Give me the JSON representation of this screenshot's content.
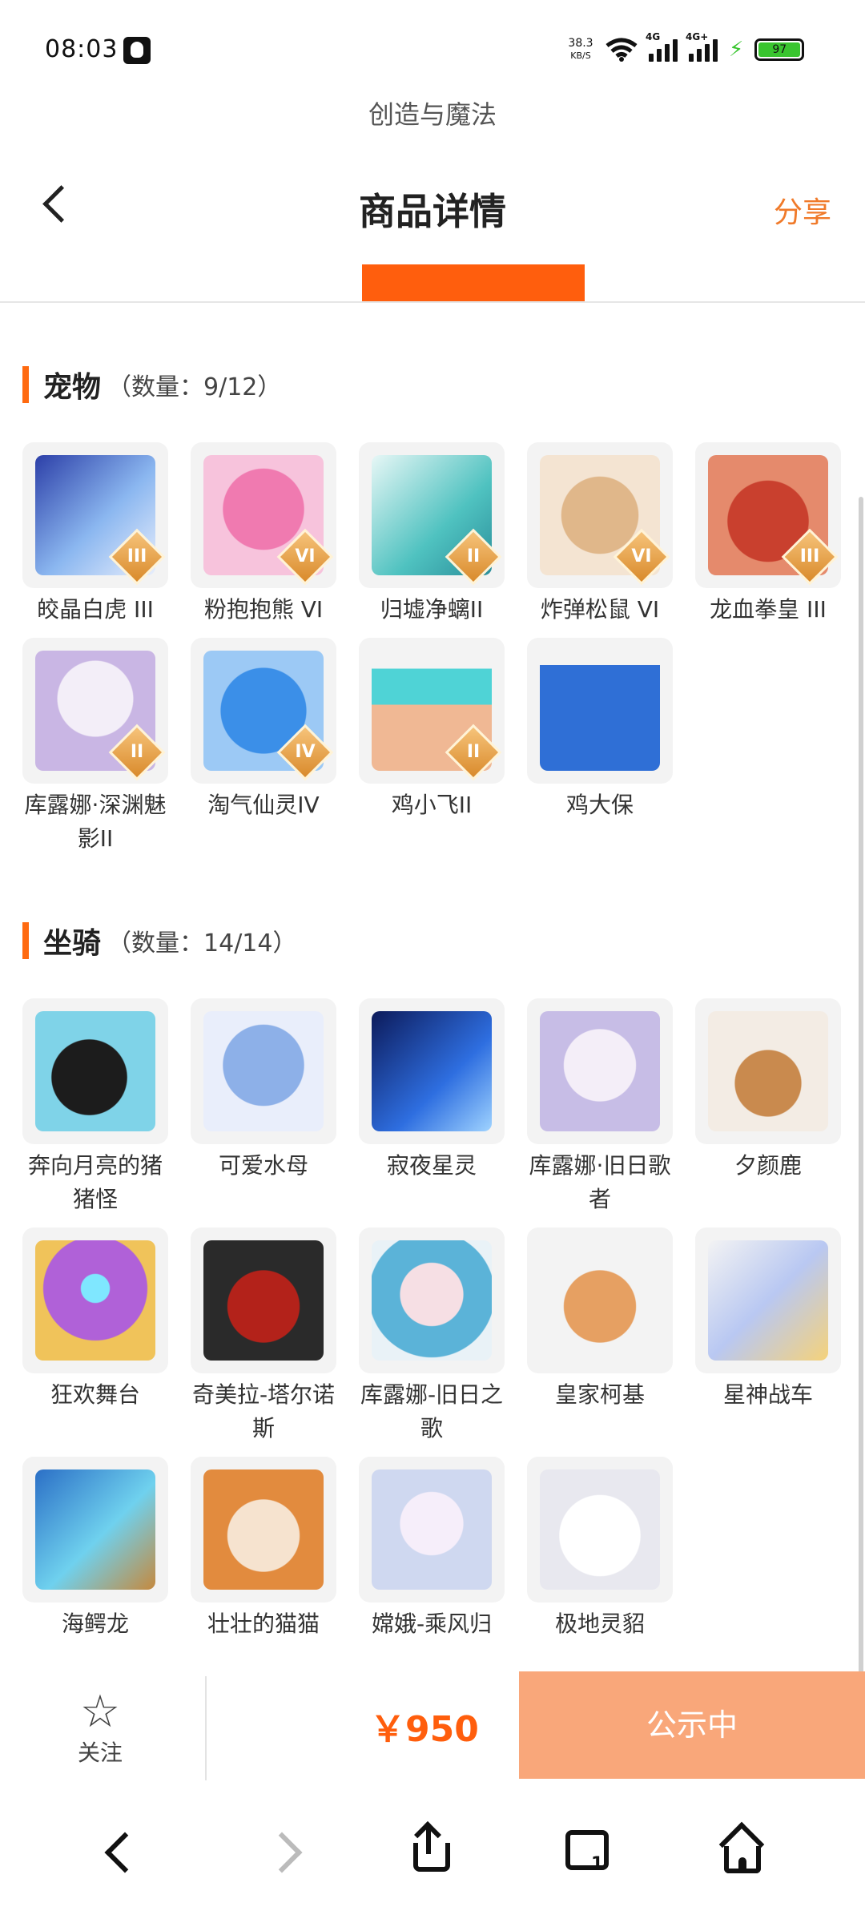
{
  "status_bar": {
    "time": "08:03",
    "net_speed_value": "38.3",
    "net_speed_unit": "KB/S",
    "signal1_tag": "4G",
    "signal2_tag": "4G+",
    "battery": "97"
  },
  "app_name": "创造与魔法",
  "nav": {
    "title": "商品详情",
    "share": "分享"
  },
  "pets": {
    "title": "宠物",
    "count": "（数量：9/12）",
    "items": [
      {
        "name": "皎晶白虎 III",
        "grade": "III"
      },
      {
        "name": "粉抱抱熊 VI",
        "grade": "VI"
      },
      {
        "name": "归墟净螭II",
        "grade": "II"
      },
      {
        "name": "炸弹松鼠 VI",
        "grade": "VI"
      },
      {
        "name": "龙血拳皇 III",
        "grade": "III"
      },
      {
        "name": "库露娜·深渊魅影II",
        "grade": "II"
      },
      {
        "name": "淘气仙灵IV",
        "grade": "IV"
      },
      {
        "name": "鸡小飞II",
        "grade": "II"
      },
      {
        "name": "鸡大保",
        "grade": ""
      }
    ]
  },
  "mounts": {
    "title": "坐骑",
    "count": "（数量：14/14）",
    "items": [
      {
        "name": "奔向月亮的猪猪怪"
      },
      {
        "name": "可爱水母"
      },
      {
        "name": "寂夜星灵"
      },
      {
        "name": "库露娜·旧日歌者"
      },
      {
        "name": "夕颜鹿"
      },
      {
        "name": "狂欢舞台"
      },
      {
        "name": "奇美拉-塔尔诺斯"
      },
      {
        "name": "库露娜-旧日之歌"
      },
      {
        "name": "皇家柯基"
      },
      {
        "name": "星神战车"
      },
      {
        "name": "海鳄龙"
      },
      {
        "name": "壮壮的猫猫"
      },
      {
        "name": "嫦娥-乘风归"
      },
      {
        "name": "极地灵貂"
      }
    ]
  },
  "bottom_bar": {
    "follow": "关注",
    "price": "￥950",
    "status": "公示中"
  },
  "colors": {
    "accent": "#ff5e0d",
    "status_button": "#f9a77a",
    "share": "#f07a2a"
  },
  "icons": [
    "back-icon",
    "star-icon",
    "browser-back-icon",
    "browser-forward-icon",
    "share-icon",
    "tabs-icon",
    "home-icon"
  ],
  "browser_nav": {
    "tab_count": "1"
  }
}
